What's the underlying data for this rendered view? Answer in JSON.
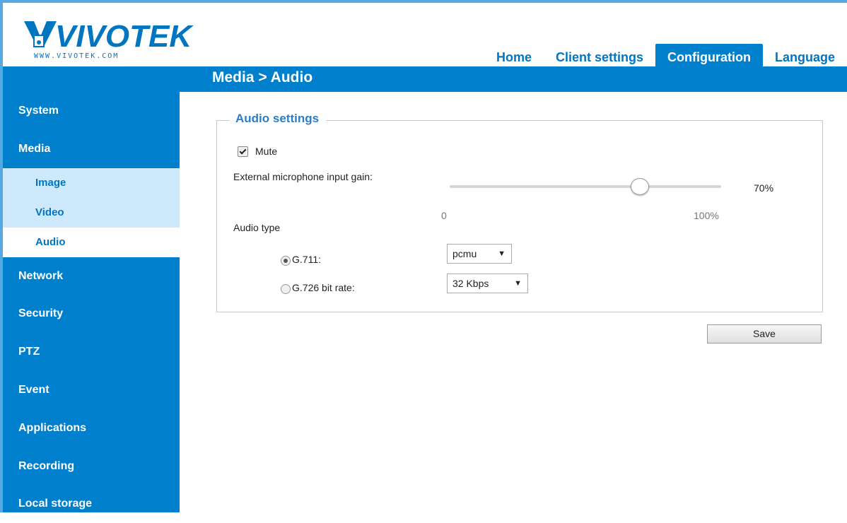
{
  "brand": {
    "name": "VIVOTEK",
    "url": "WWW.VIVOTEK.COM"
  },
  "topnav": [
    {
      "label": "Home",
      "active": false
    },
    {
      "label": "Client settings",
      "active": false
    },
    {
      "label": "Configuration",
      "active": true
    },
    {
      "label": "Language",
      "active": false
    }
  ],
  "breadcrumb": "Media  > Audio",
  "sidebar": {
    "items": [
      {
        "label": "System"
      },
      {
        "label": "Media"
      }
    ],
    "subitems": [
      {
        "label": "Image",
        "active": false
      },
      {
        "label": "Video",
        "active": false
      },
      {
        "label": "Audio",
        "active": true
      }
    ],
    "items_after": [
      {
        "label": "Network"
      },
      {
        "label": "Security"
      },
      {
        "label": "PTZ"
      },
      {
        "label": "Event"
      },
      {
        "label": "Applications"
      },
      {
        "label": "Recording"
      },
      {
        "label": "Local storage"
      }
    ]
  },
  "audio_settings": {
    "legend": "Audio settings",
    "mute_label": "Mute",
    "mute_checked": true,
    "gain_label": "External microphone input gain:",
    "gain_value": "70%",
    "gain_level": 70,
    "gain_min": "0",
    "gain_max": "100%",
    "audio_type_label": "Audio type",
    "g711_label": "G.711:",
    "g711_selected": true,
    "g711_value": "pcmu",
    "g726_label": "G.726 bit rate:",
    "g726_selected": false,
    "g726_value": "32 Kbps"
  },
  "save_label": "Save",
  "colors": {
    "accent": "#0080cc",
    "sub_bg": "#cde9fb",
    "legend": "#2d7dc4"
  }
}
